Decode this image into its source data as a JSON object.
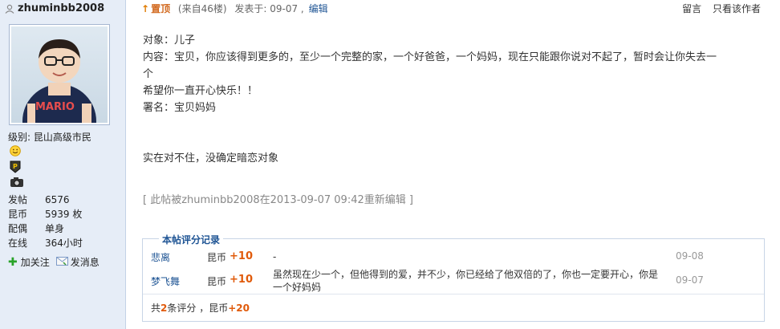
{
  "user": {
    "name": "zhuminbb2008",
    "level_label": "级别: 昆山高级市民",
    "stats": [
      {
        "label": "发帖",
        "value": "6576"
      },
      {
        "label": "昆币",
        "value": "5939 枚"
      },
      {
        "label": "配偶",
        "value": "单身"
      },
      {
        "label": "在线",
        "value": "364小时"
      }
    ],
    "add_follow": "加关注",
    "send_message": "发消息",
    "avatar_text": "MARIO"
  },
  "header": {
    "pin": "置顶",
    "floor": "(来自46楼)",
    "posted": "发表于: 09-07 ,",
    "edit": "编辑",
    "reply": "留言",
    "only_author": "只看该作者"
  },
  "post": {
    "line1": "对象：儿子",
    "line2": "内容：宝贝，你应该得到更多的，至少一个完整的家，一个好爸爸，一个妈妈，现在只能跟你说对不起了，暂时会让你失去一",
    "line2b": "个",
    "line3": "希望你一直开心快乐！！",
    "line4": "署名：宝贝妈妈",
    "line5": "实在对不住，没确定暗恋对象",
    "edit_note": "[ 此帖被zhuminbb2008在2013-09-07 09:42重新编辑 ]"
  },
  "rating": {
    "title": "本帖评分记录",
    "rows": [
      {
        "rater": "悲离",
        "currency": "昆币",
        "amount": "+10",
        "comment": "-",
        "date": "09-08"
      },
      {
        "rater": "梦飞舞",
        "currency": "昆币",
        "amount": "+10",
        "comment": "虽然现在少一个，但他得到的爱，并不少，你已经给了他双倍的了，你也一定要开心，你是一个好妈妈",
        "date": "09-07"
      }
    ],
    "summary_prefix": "共",
    "summary_count": "2",
    "summary_mid": "条评分 ，昆币",
    "summary_total": "+20"
  },
  "colors": {
    "sidebar_bg": "#e6edf7",
    "link": "#1e5494",
    "accent_orange": "#e05a0a"
  }
}
